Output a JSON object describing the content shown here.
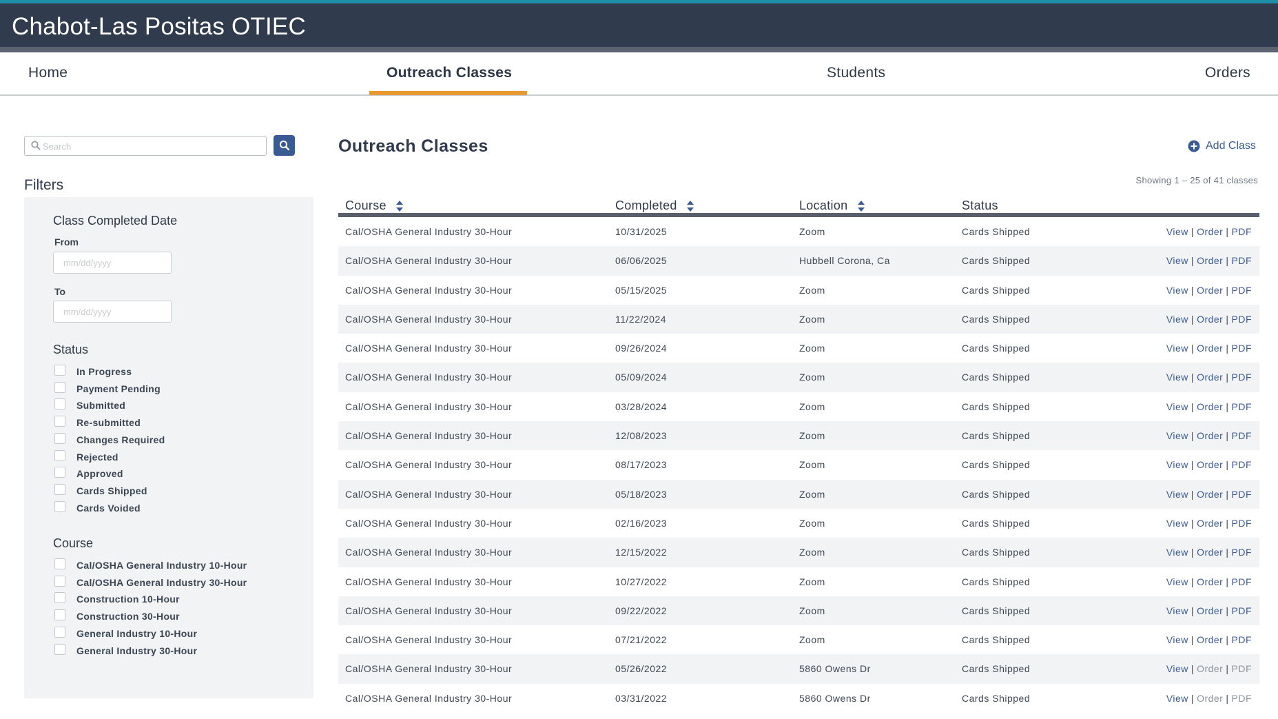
{
  "header": {
    "app_title": "Chabot-Las Positas OTIEC"
  },
  "nav": {
    "tabs": [
      {
        "label": "Home",
        "active": false
      },
      {
        "label": "Outreach Classes",
        "active": true
      },
      {
        "label": "Students",
        "active": false
      },
      {
        "label": "Orders",
        "active": false
      }
    ],
    "active_color": "#e89a31"
  },
  "search": {
    "placeholder": "Search",
    "value": ""
  },
  "filters": {
    "heading": "Filters",
    "date": {
      "title": "Class Completed Date",
      "from_label": "From",
      "to_label": "To",
      "placeholder": "mm/dd/yyyy"
    },
    "status": {
      "title": "Status",
      "options": [
        "In Progress",
        "Payment Pending",
        "Submitted",
        "Re-submitted",
        "Changes Required",
        "Rejected",
        "Approved",
        "Cards Shipped",
        "Cards Voided"
      ]
    },
    "course": {
      "title": "Course",
      "options": [
        "Cal/OSHA General Industry 10-Hour",
        "Cal/OSHA General Industry 30-Hour",
        "Construction 10-Hour",
        "Construction 30-Hour",
        "General Industry 10-Hour",
        "General Industry 30-Hour"
      ]
    }
  },
  "main": {
    "title": "Outreach Classes",
    "add_label": "Add Class",
    "showing": "Showing 1 – 25 of 41 classes",
    "columns": {
      "course": "Course",
      "completed": "Completed",
      "location": "Location",
      "status": "Status"
    },
    "actions": {
      "view": "View",
      "order": "Order",
      "pdf": "PDF",
      "sep": "|"
    },
    "rows": [
      {
        "course": "Cal/OSHA General Industry 30-Hour",
        "completed": "10/31/2025",
        "location": "Zoom",
        "status": "Cards Shipped",
        "actions_enabled": true
      },
      {
        "course": "Cal/OSHA General Industry 30-Hour",
        "completed": "06/06/2025",
        "location": "Hubbell Corona, Ca",
        "status": "Cards Shipped",
        "actions_enabled": true
      },
      {
        "course": "Cal/OSHA General Industry 30-Hour",
        "completed": "05/15/2025",
        "location": "Zoom",
        "status": "Cards Shipped",
        "actions_enabled": true
      },
      {
        "course": "Cal/OSHA General Industry 30-Hour",
        "completed": "11/22/2024",
        "location": "Zoom",
        "status": "Cards Shipped",
        "actions_enabled": true
      },
      {
        "course": "Cal/OSHA General Industry 30-Hour",
        "completed": "09/26/2024",
        "location": "Zoom",
        "status": "Cards Shipped",
        "actions_enabled": true
      },
      {
        "course": "Cal/OSHA General Industry 30-Hour",
        "completed": "05/09/2024",
        "location": "Zoom",
        "status": "Cards Shipped",
        "actions_enabled": true
      },
      {
        "course": "Cal/OSHA General Industry 30-Hour",
        "completed": "03/28/2024",
        "location": "Zoom",
        "status": "Cards Shipped",
        "actions_enabled": true
      },
      {
        "course": "Cal/OSHA General Industry 30-Hour",
        "completed": "12/08/2023",
        "location": "Zoom",
        "status": "Cards Shipped",
        "actions_enabled": true
      },
      {
        "course": "Cal/OSHA General Industry 30-Hour",
        "completed": "08/17/2023",
        "location": "Zoom",
        "status": "Cards Shipped",
        "actions_enabled": true
      },
      {
        "course": "Cal/OSHA General Industry 30-Hour",
        "completed": "05/18/2023",
        "location": "Zoom",
        "status": "Cards Shipped",
        "actions_enabled": true
      },
      {
        "course": "Cal/OSHA General Industry 30-Hour",
        "completed": "02/16/2023",
        "location": "Zoom",
        "status": "Cards Shipped",
        "actions_enabled": true
      },
      {
        "course": "Cal/OSHA General Industry 30-Hour",
        "completed": "12/15/2022",
        "location": "Zoom",
        "status": "Cards Shipped",
        "actions_enabled": true
      },
      {
        "course": "Cal/OSHA General Industry 30-Hour",
        "completed": "10/27/2022",
        "location": "Zoom",
        "status": "Cards Shipped",
        "actions_enabled": true
      },
      {
        "course": "Cal/OSHA General Industry 30-Hour",
        "completed": "09/22/2022",
        "location": "Zoom",
        "status": "Cards Shipped",
        "actions_enabled": true
      },
      {
        "course": "Cal/OSHA General Industry 30-Hour",
        "completed": "07/21/2022",
        "location": "Zoom",
        "status": "Cards Shipped",
        "actions_enabled": true
      },
      {
        "course": "Cal/OSHA General Industry 30-Hour",
        "completed": "05/26/2022",
        "location": "5860 Owens Dr",
        "status": "Cards Shipped",
        "actions_enabled": false
      },
      {
        "course": "Cal/OSHA General Industry 30-Hour",
        "completed": "03/31/2022",
        "location": "5860 Owens Dr",
        "status": "Cards Shipped",
        "actions_enabled": false
      }
    ]
  }
}
